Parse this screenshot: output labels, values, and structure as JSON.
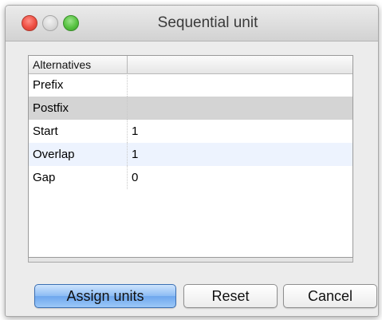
{
  "window": {
    "title": "Sequential unit"
  },
  "table": {
    "headers": [
      "Alternatives",
      ""
    ],
    "rows": [
      {
        "name": "Prefix",
        "value": ""
      },
      {
        "name": "Postfix",
        "value": ""
      },
      {
        "name": "Start",
        "value": "1"
      },
      {
        "name": "Overlap",
        "value": "1"
      },
      {
        "name": "Gap",
        "value": "0"
      }
    ],
    "selected_row": "Postfix"
  },
  "buttons": {
    "assign_label": "Assign units",
    "reset_label": "Reset",
    "cancel_label": "Cancel"
  },
  "colors": {
    "close": "#ee4e42",
    "minimize": "#d8d8d8",
    "maximize": "#56c240",
    "primary_button": "#8cbcf4",
    "row_alt": "#edf3fe",
    "row_selected": "#d4d4d4"
  }
}
